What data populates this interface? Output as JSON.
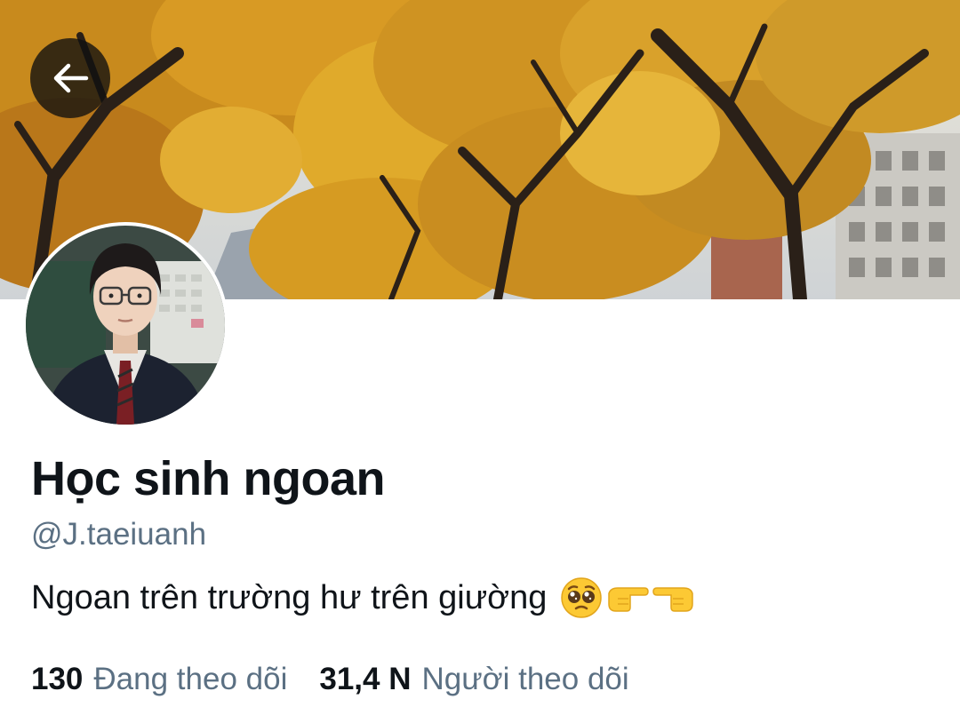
{
  "profile": {
    "display_name": "Học sinh ngoan",
    "handle": "@J.taeiuanh",
    "bio": "Ngoan trên trường hư trên giường",
    "bio_emojis": [
      "pleading-face-emoji",
      "pointing-right-emoji",
      "pointing-left-emoji"
    ]
  },
  "stats": {
    "following_count": "130",
    "following_label": "Đang theo dõi",
    "followers_count": "31,4 N",
    "followers_label": "Người theo dõi"
  },
  "icons": {
    "back": "back-arrow-icon"
  },
  "colors": {
    "text_primary": "#0f1419",
    "text_secondary": "#5b7083",
    "background": "#ffffff",
    "back_button_bg": "#1a1a1a"
  }
}
